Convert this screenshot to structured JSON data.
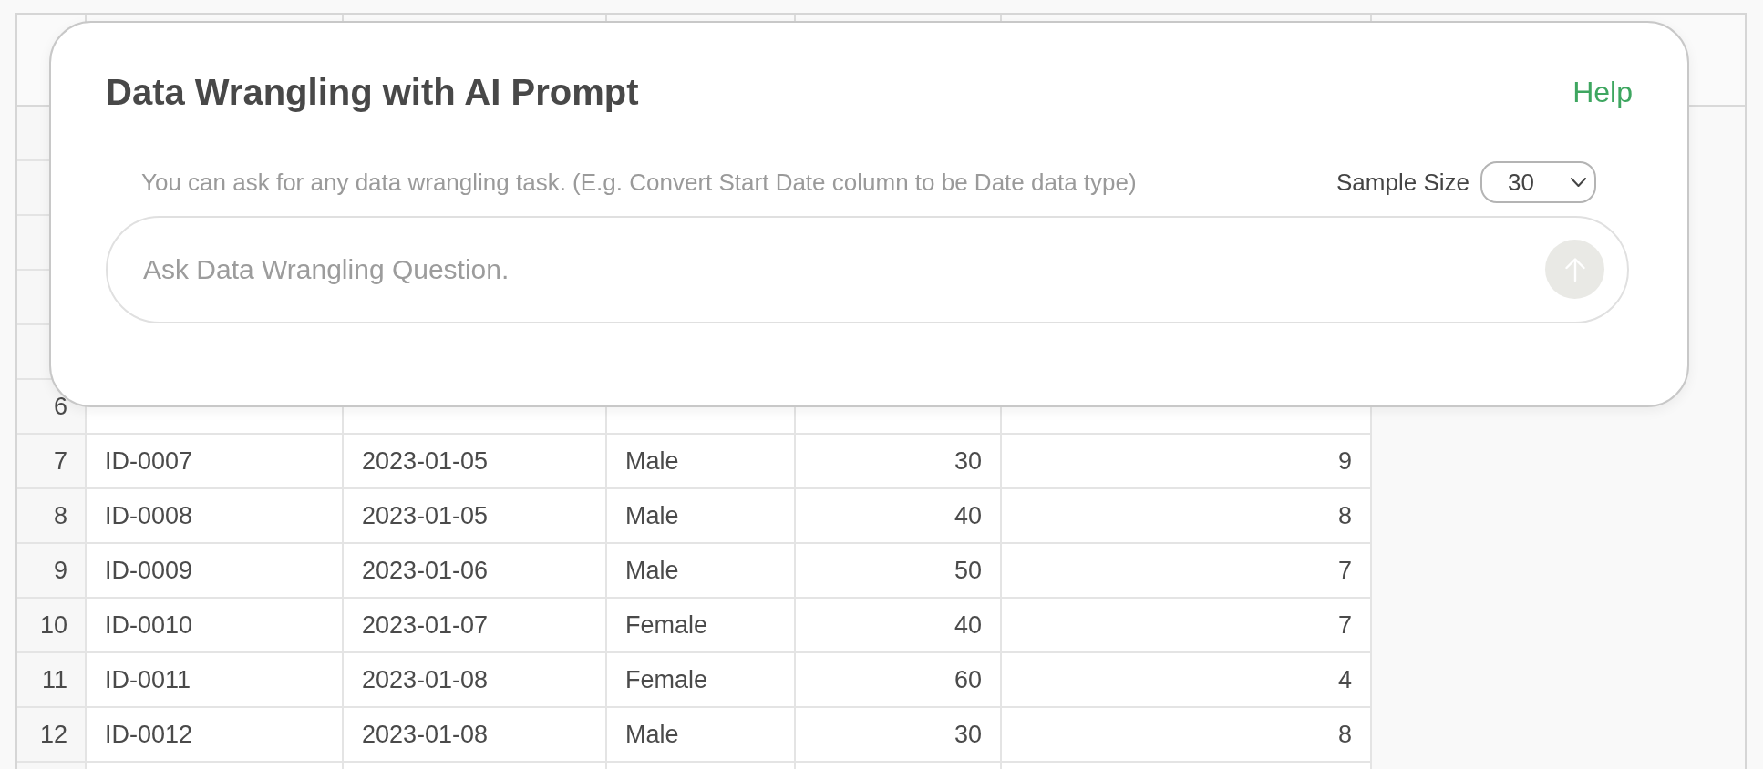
{
  "table": {
    "rows": [
      {
        "number": "6"
      },
      {
        "number": "7",
        "cells": [
          "ID-0007",
          "2023-01-05",
          "Male",
          "30",
          "9"
        ]
      },
      {
        "number": "8",
        "cells": [
          "ID-0008",
          "2023-01-05",
          "Male",
          "40",
          "8"
        ]
      },
      {
        "number": "9",
        "cells": [
          "ID-0009",
          "2023-01-06",
          "Male",
          "50",
          "7"
        ]
      },
      {
        "number": "10",
        "cells": [
          "ID-0010",
          "2023-01-07",
          "Female",
          "40",
          "7"
        ]
      },
      {
        "number": "11",
        "cells": [
          "ID-0011",
          "2023-01-08",
          "Female",
          "60",
          "4"
        ]
      },
      {
        "number": "12",
        "cells": [
          "ID-0012",
          "2023-01-08",
          "Male",
          "30",
          "8"
        ]
      }
    ]
  },
  "dialog": {
    "title": "Data Wrangling with AI Prompt",
    "help_link": "Help",
    "hint": "You can ask for any data wrangling task. (E.g. Convert Start Date column to be Date data type)",
    "sample_size": {
      "label": "Sample Size",
      "value": "30"
    },
    "question_input": {
      "placeholder": "Ask Data Wrangling Question."
    },
    "send_button": {
      "disabled": true
    }
  }
}
